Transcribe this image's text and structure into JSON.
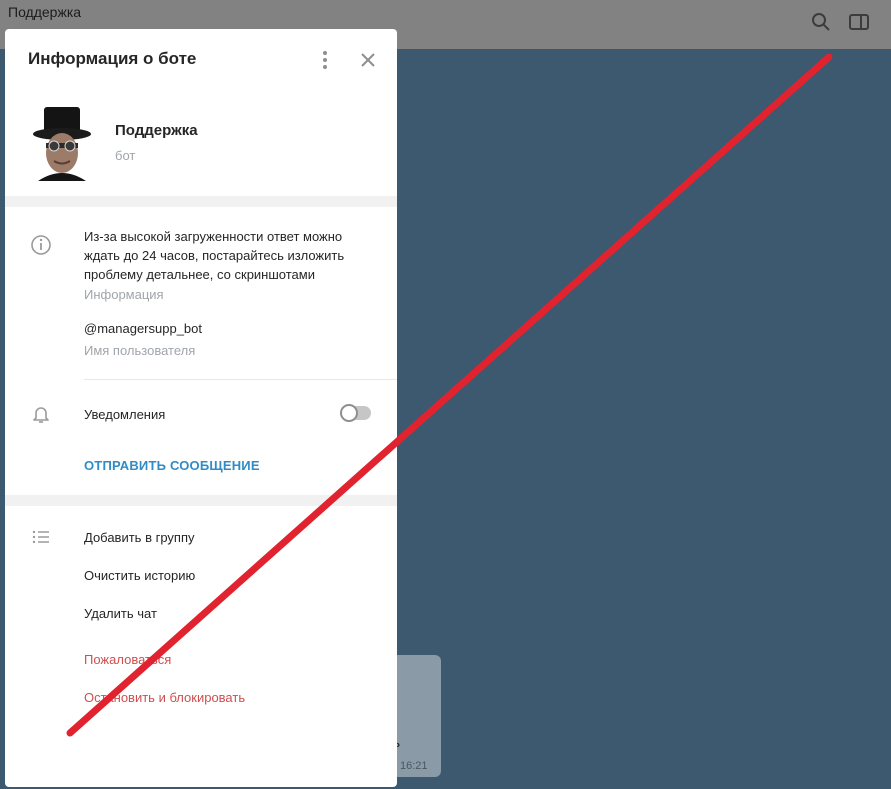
{
  "app": {
    "chat_title": "Поддержка",
    "bubble_text": "ить",
    "bubble_time": "16:21"
  },
  "modal": {
    "title": "Информация о боте",
    "profile": {
      "name": "Поддержка",
      "subtitle": "бот"
    },
    "info": {
      "description": "Из-за высокой загруженности ответ можно ждать до 24 часов, постарайтесь изложить проблему детальнее, со скриншотами",
      "description_caption": "Информация",
      "username": "@managersupp_bot",
      "username_caption": "Имя пользователя"
    },
    "notifications": {
      "label": "Уведомления",
      "enabled": false
    },
    "send_message_label": "ОТПРАВИТЬ СООБЩЕНИЕ",
    "actions": [
      {
        "label": "Добавить в группу"
      },
      {
        "label": "Очистить историю"
      },
      {
        "label": "Удалить чат"
      },
      {
        "label": "Пожаловаться"
      },
      {
        "label": "Остановить и блокировать"
      }
    ]
  },
  "icons": {
    "search": "search-icon",
    "sidebar": "sidebar-toggle-icon",
    "more": "more-vertical-icon",
    "close": "close-icon",
    "info": "info-icon",
    "bell": "bell-icon",
    "list": "list-icon"
  },
  "colors": {
    "accent": "#2f8cc6",
    "danger": "#d14e4e",
    "overlay_line": "#e0232e"
  }
}
